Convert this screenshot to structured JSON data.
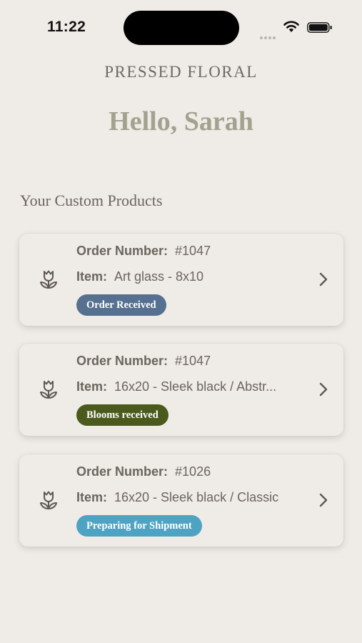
{
  "status_bar": {
    "time": "11:22"
  },
  "header": {
    "brand": "PRESSED FLORAL",
    "greeting": "Hello, Sarah"
  },
  "section": {
    "title": "Your Custom Products"
  },
  "labels": {
    "order_number": "Order Number:",
    "item": "Item:"
  },
  "orders": [
    {
      "number": "#1047",
      "item": "Art glass - 8x10",
      "status": "Order Received",
      "status_color": "#56708f"
    },
    {
      "number": "#1047",
      "item": "16x20 - Sleek black / Abstr...",
      "status": "Blooms received",
      "status_color": "#4a5a1c"
    },
    {
      "number": "#1026",
      "item": "16x20 - Sleek black / Classic",
      "status": "Preparing for Shipment",
      "status_color": "#4fa3c2"
    }
  ],
  "icons": {
    "card": "tulip-icon",
    "row_action": "chevron-right-icon"
  }
}
